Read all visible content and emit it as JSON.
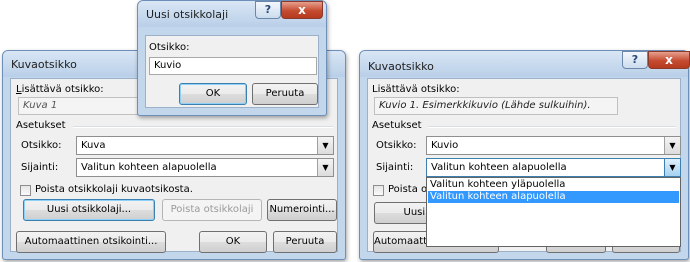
{
  "left_dialog": {
    "title": "Kuvaotsikko",
    "caption_label": "Lisättävä otsikko:",
    "caption_value": "Kuva 1",
    "settings_label": "Asetukset",
    "label_label": "Otsikko:",
    "label_value": "Kuva",
    "position_label": "Sijainti:",
    "position_value": "Valitun kohteen alapuolella",
    "exclude_label": "Poista otsikkolaji kuvaotsikosta.",
    "new_label_button": "Uusi otsikkolaji...",
    "delete_label_button": "Poista otsikkolaji",
    "numbering_button": "Numerointi...",
    "autocaption_button": "Automaattinen otsikointi...",
    "ok_button": "OK",
    "cancel_button": "Peruuta"
  },
  "new_label_dialog": {
    "title": "Uusi otsikkolaji",
    "label_label": "Otsikko:",
    "label_value": "Kuvio",
    "ok_button": "OK",
    "cancel_button": "Peruuta",
    "help_glyph": "?",
    "close_glyph": "x"
  },
  "right_dialog": {
    "title": "Kuvaotsikko",
    "caption_label": "Lisättävä otsikko:",
    "caption_value": "Kuvio 1. Esimerkkikuvio (Lähde sulkuihin).",
    "settings_label": "Asetukset",
    "label_label": "Otsikko:",
    "label_value": "Kuvio",
    "position_label": "Sijainti:",
    "position_value": "Valitun kohteen alapuolella",
    "exclude_label": "Poista o",
    "new_label_button": "Uusi o",
    "autocaption_button": "Automaattinen otsikointi...",
    "ok_button": "OK",
    "cancel_button": "Sulje",
    "help_glyph": "?",
    "close_glyph": "x",
    "position_options": [
      "Valitun kohteen yläpuolella",
      "Valitun kohteen alapuolella"
    ],
    "selected_option": "Valitun kohteen alapuolella"
  }
}
